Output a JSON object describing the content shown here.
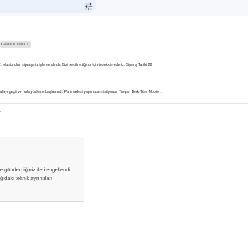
{
  "toolbar": {
    "filter_icon": "tune-icon"
  },
  "label_chip": {
    "label": "Gelen Kutusu",
    "close": "×"
  },
  "message": {
    "line1": "1 oluşturulan siparişiniz işleme alındı. Bizi tercih ettiğiniz için teşekkür ederiz. Sipariş Tarihi 28",
    "line2": "afayı geçti ve hala yükleme başlamadı. Para iadesi yapılmasını istiyorum Targan Berk Türe Mobile :",
    "line3": "-"
  },
  "bounce_notice": {
    "line1": "e gönderdiğiniz ileti engellendi.",
    "line2": "ğıdaki teknik ayrıntıları"
  },
  "colors": {
    "topbar_bg": "#f6f8fc",
    "search_bg": "#eaf1fb",
    "chip_bg": "#e2e2e2",
    "notice_bg": "#f8f8f8"
  }
}
